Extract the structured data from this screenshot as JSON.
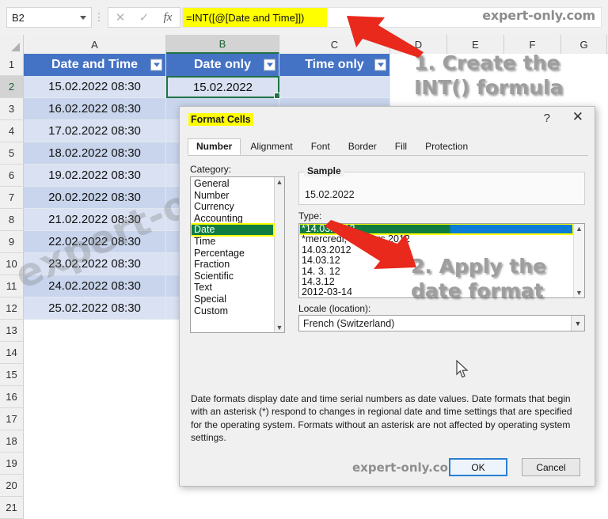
{
  "formula_bar": {
    "name_box_value": "B2",
    "cancel_icon": "close-icon",
    "enter_icon": "check-icon",
    "function_icon": "fx-icon",
    "formula": "=INT([@[Date and Time]])",
    "watermark": "expert-only.com"
  },
  "sheet": {
    "column_headers": [
      "A",
      "B",
      "C",
      "D",
      "E",
      "F",
      "G"
    ],
    "selected_column": "B",
    "selected_cell": "B2",
    "row_numbers": [
      "1",
      "2",
      "3",
      "4",
      "5",
      "6",
      "7",
      "8",
      "9",
      "10",
      "11",
      "12",
      "13",
      "14",
      "15",
      "16",
      "17",
      "18",
      "19",
      "20",
      "21"
    ],
    "table_headers": [
      "Date and Time",
      "Date only",
      "Time only"
    ],
    "rows": [
      {
        "row": "2",
        "date_time": "15.02.2022 08:30",
        "date_only": "15.02.2022",
        "time_only": ""
      },
      {
        "row": "3",
        "date_time": "16.02.2022 08:30",
        "date_only": "",
        "time_only": ""
      },
      {
        "row": "4",
        "date_time": "17.02.2022 08:30",
        "date_only": "",
        "time_only": ""
      },
      {
        "row": "5",
        "date_time": "18.02.2022 08:30",
        "date_only": "",
        "time_only": ""
      },
      {
        "row": "6",
        "date_time": "19.02.2022 08:30",
        "date_only": "",
        "time_only": ""
      },
      {
        "row": "7",
        "date_time": "20.02.2022 08:30",
        "date_only": "",
        "time_only": ""
      },
      {
        "row": "8",
        "date_time": "21.02.2022 08:30",
        "date_only": "",
        "time_only": ""
      },
      {
        "row": "9",
        "date_time": "22.02.2022 08:30",
        "date_only": "",
        "time_only": ""
      },
      {
        "row": "10",
        "date_time": "23.02.2022 08:30",
        "date_only": "",
        "time_only": ""
      },
      {
        "row": "11",
        "date_time": "24.02.2022 08:30",
        "date_only": "",
        "time_only": ""
      },
      {
        "row": "12",
        "date_time": "25.02.2022 08:30",
        "date_only": "",
        "time_only": ""
      }
    ],
    "watermark": "expert-only.com"
  },
  "annotations": {
    "step1": "1. Create the\nINT() formula",
    "step2": "2. Apply the\ndate format"
  },
  "dialog": {
    "title": "Format Cells",
    "help_icon": "?",
    "close_icon": "✕",
    "tabs": [
      "Number",
      "Alignment",
      "Font",
      "Border",
      "Fill",
      "Protection"
    ],
    "active_tab": "Number",
    "category_label": "Category:",
    "categories": [
      "General",
      "Number",
      "Currency",
      "Accounting",
      "Date",
      "Time",
      "Percentage",
      "Fraction",
      "Scientific",
      "Text",
      "Special",
      "Custom"
    ],
    "selected_category": "Date",
    "sample_label": "Sample",
    "sample_value": "15.02.2022",
    "type_label": "Type:",
    "types": [
      "*14.03.2012",
      "*mercredi, 14 mars 2012",
      "14.03.2012",
      "14.03.12",
      "14. 3. 12",
      "14.3.12",
      "2012-03-14"
    ],
    "selected_type": "*14.03.2012",
    "locale_label": "Locale (location):",
    "locale_value": "French (Switzerland)",
    "description": "Date formats display date and time serial numbers as date values.  Date formats that begin with an asterisk (*) respond to changes in regional date and time settings that are specified for the operating system. Formats without an asterisk are not affected by operating system settings.",
    "ok_label": "OK",
    "cancel_label": "Cancel",
    "watermark": "expert-only.com"
  },
  "colors": {
    "excel_green": "#217346",
    "table_header_blue": "#4472c4",
    "highlight_yellow": "#ffff00",
    "selection_green": "#107c41",
    "selection_blue": "#0b7dd6",
    "arrow_red": "#e8291c"
  }
}
